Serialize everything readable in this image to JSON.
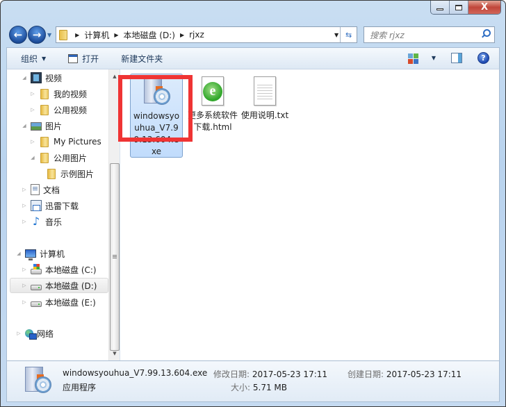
{
  "window": {
    "controls": {
      "minimize": "minimize",
      "maximize": "maximize",
      "close": "X"
    }
  },
  "nav": {
    "back_icon": "back-arrow-icon",
    "forward_icon": "forward-arrow-icon",
    "breadcrumb": [
      "计算机",
      "本地磁盘 (D:)",
      "rjxz"
    ],
    "search_placeholder": "搜索 rjxz"
  },
  "toolbar": {
    "organize": "组织",
    "open": "打开",
    "new_folder": "新建文件夹"
  },
  "sidebar": {
    "items": [
      {
        "label": "视频",
        "icon": "video-library-icon",
        "expander": "expanded"
      },
      {
        "label": "我的视频",
        "icon": "folder-icon",
        "expander": "collapsed"
      },
      {
        "label": "公用视频",
        "icon": "folder-icon",
        "expander": "collapsed"
      },
      {
        "label": "图片",
        "icon": "pictures-library-icon",
        "expander": "expanded"
      },
      {
        "label": "My Pictures",
        "icon": "folder-icon",
        "expander": "collapsed"
      },
      {
        "label": "公用图片",
        "icon": "folder-icon",
        "expander": "expanded"
      },
      {
        "label": "示例图片",
        "icon": "folder-icon",
        "expander": "none"
      },
      {
        "label": "文档",
        "icon": "documents-library-icon",
        "expander": "collapsed"
      },
      {
        "label": "迅雷下载",
        "icon": "download-library-icon",
        "expander": "collapsed"
      },
      {
        "label": "音乐",
        "icon": "music-library-icon",
        "expander": "collapsed"
      },
      {
        "label": "计算机",
        "icon": "computer-icon",
        "expander": "expanded"
      },
      {
        "label": "本地磁盘 (C:)",
        "icon": "system-drive-icon",
        "expander": "collapsed"
      },
      {
        "label": "本地磁盘 (D:)",
        "icon": "drive-icon",
        "expander": "collapsed",
        "selected": true
      },
      {
        "label": "本地磁盘 (E:)",
        "icon": "drive-icon",
        "expander": "collapsed"
      },
      {
        "label": "网络",
        "icon": "network-icon",
        "expander": "collapsed"
      }
    ]
  },
  "files": [
    {
      "name": "windowsyouhua_V7.99.13.604.exe",
      "icon": "setup-exe-icon",
      "selected": true
    },
    {
      "name": "更多系统软件下载.html",
      "icon": "html-ie-icon"
    },
    {
      "name": "使用说明.txt",
      "icon": "text-file-icon"
    }
  ],
  "details": {
    "filename": "windowsyouhua_V7.99.13.604.exe",
    "type": "应用程序",
    "modified_label": "修改日期:",
    "modified_value": "2017-05-23 17:11",
    "created_label": "创建日期:",
    "created_value": "2017-05-23 17:11",
    "size_label": "大小:",
    "size_value": "5.71 MB"
  },
  "colors": {
    "highlight_box": "#ef3434",
    "selection": "#c1dcfc"
  }
}
